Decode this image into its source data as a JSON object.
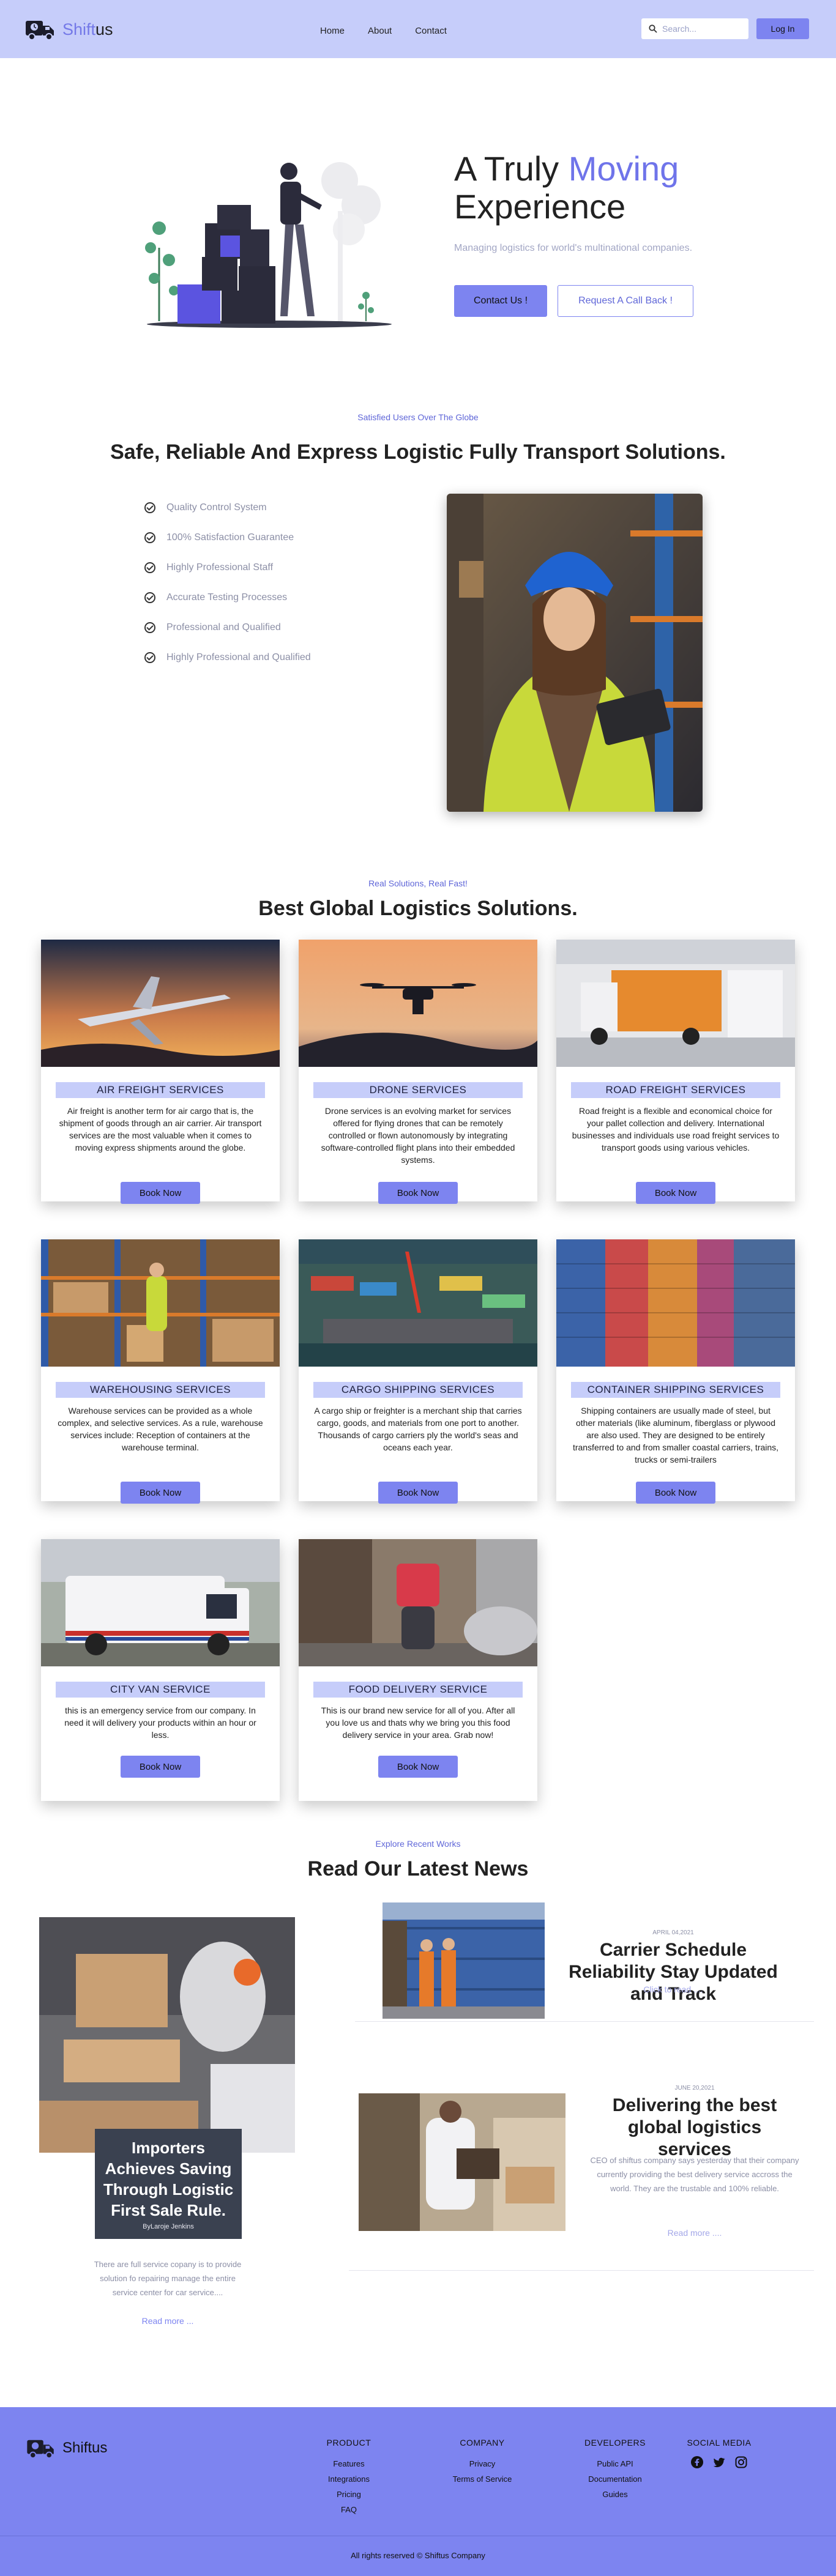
{
  "header": {
    "brand_accent": "Shift",
    "brand_rest": "us",
    "nav": [
      "Home",
      "About",
      "Contact"
    ],
    "search_placeholder": "Search...",
    "login_label": "Log In"
  },
  "hero": {
    "title_pre": "A Truly ",
    "title_accent": "Moving",
    "title_post": "Experience",
    "subtitle": "Managing logistics for world's multinational companies.",
    "primary_label": "Contact Us !",
    "secondary_label": "Request A Call Back !"
  },
  "about": {
    "eyebrow": "Satisfied Users Over The Globe",
    "title": "Safe, Reliable And Express Logistic Fully Transport Solutions.",
    "features": [
      "Quality Control System",
      "100% Satisfaction Guarantee",
      "Highly Professional Staff",
      "Accurate Testing Processes",
      "Professional and Qualified",
      "Highly Professional and Qualified"
    ]
  },
  "services": {
    "eyebrow": "Real Solutions, Real Fast!",
    "title": "Best Global Logistics Solutions.",
    "book_label": "Book Now",
    "items": [
      {
        "title": "AIR FREIGHT SERVICES",
        "desc": "Air freight is another term for air cargo that is, the shipment of goods through an air carrier. Air transport services are the most valuable when it comes to moving express shipments around the globe."
      },
      {
        "title": "DRONE SERVICES",
        "desc": "Drone services is an evolving market for services offered for flying drones that can be remotely controlled or flown autonomously by integrating software-controlled flight plans into their embedded systems."
      },
      {
        "title": "ROAD FREIGHT SERVICES",
        "desc": "Road freight is a flexible and economical choice for your pallet collection and delivery. International businesses and individuals use road freight services to transport goods using various vehicles."
      },
      {
        "title": "WAREHOUSING SERVICES",
        "desc": "Warehouse services can be provided as a whole complex, and selective services. As a rule, warehouse services include: Reception of containers at the warehouse terminal."
      },
      {
        "title": "CARGO SHIPPING SERVICES",
        "desc": "A cargo ship or freighter is a merchant ship that carries cargo, goods, and materials from one port to another. Thousands of cargo carriers ply the world's seas and oceans each year."
      },
      {
        "title": "CONTAINER SHIPPING SERVICES",
        "desc": "Shipping containers are usually made of steel, but other materials (like aluminum, fiberglass or plywood are also used. They are designed to be entirely transferred to and from smaller coastal carriers, trains, trucks or semi-trailers"
      },
      {
        "title": "CITY VAN SERVICE",
        "desc": "this is an emergency service from our company. In need it will delivery your products within an hour or less."
      },
      {
        "title": "FOOD DELIVERY SERVICE",
        "desc": "This is our brand new service for all of you. After all you love us and thats why we bring you this food delivery service in your area. Grab now!"
      }
    ]
  },
  "news": {
    "eyebrow": "Explore Recent Works",
    "title": "Read Our Latest News",
    "feature": {
      "title": "Importers Achieves Saving Through Logistic First Sale Rule.",
      "byline": "ByLaroje Jenkins",
      "text": "There are full service copany is to provide solution fo repairing manage the entire service center for car service....",
      "read_more": "Read more ..."
    },
    "card1": {
      "date": "APRIL 04,2021",
      "title": "Carrier Schedule Reliability Stay Updated and Track",
      "link": "Click to read ...."
    },
    "card2": {
      "date": "JUNE 20,2021",
      "title": "Delivering the best global logistics services",
      "body": "CEO of shiftus company says yesterday that their company currently providing the best delivery service accross the world. They are the trustable and 100% reliable.",
      "link": "Read more ...."
    }
  },
  "footer": {
    "brand": "Shiftus",
    "columns": [
      {
        "heading": "PRODUCT",
        "links": [
          "Features",
          "Integrations",
          "Pricing",
          "FAQ"
        ]
      },
      {
        "heading": "COMPANY",
        "links": [
          "Privacy",
          "Terms of Service"
        ]
      },
      {
        "heading": "DEVELOPERS",
        "links": [
          "Public API",
          "Documentation",
          "Guides"
        ]
      }
    ],
    "social_heading": "SOCIAL MEDIA",
    "social_icons": [
      "facebook-icon",
      "twitter-icon",
      "instagram-icon"
    ],
    "copyright": "All rights reserved © Shiftus Company"
  },
  "colors": {
    "header_bg": "#c6cdfa",
    "accent": "#7d84f0",
    "accent_text": "#6f74ea",
    "muted_text": "#8c8fa6"
  }
}
